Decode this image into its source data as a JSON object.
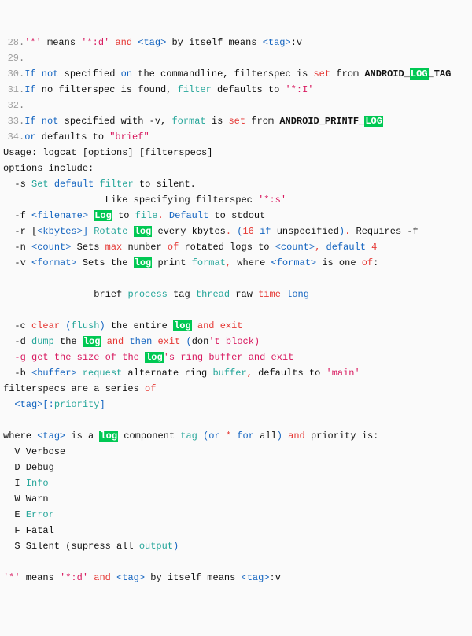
{
  "l28": {
    "ln": "28",
    "star": "'*'",
    "means": " means ",
    "starD": "'*:d'",
    "and": " and ",
    "tag": "<tag>",
    "by": " by itself means ",
    "tag2": "<tag>",
    "v": ":v"
  },
  "l29": {
    "ln": "29"
  },
  "l30": {
    "ln": "30",
    "if": "If",
    "not": " not ",
    "spec": "specified ",
    "on": "on",
    "rest": " the commandline, filterspec is ",
    "set": "set",
    "from": " from ",
    "a": "ANDROID_",
    "log": "LOG",
    "tag": "_TAG"
  },
  "l31": {
    "ln": "31",
    "if": "If",
    "rest": " no filterspec is found, ",
    "filter": "filter",
    "def": " defaults to ",
    "val": "'*:I'"
  },
  "l32": {
    "ln": "32"
  },
  "l33": {
    "ln": "33",
    "if": "If",
    "not": " not ",
    "spec": "specified with -v, ",
    "format": "format",
    "is": " is ",
    "set": "set",
    "from": " from ",
    "a": "ANDROID_PRINTF_",
    "log": "LOG"
  },
  "l34": {
    "ln": "34",
    "or": "or",
    "def": " defaults to ",
    "brief": "\"brief\""
  },
  "usage": "Usage: logcat [options] [filterspecs]",
  "opts": "options include:",
  "s": {
    "flag": "  -s ",
    "set": "Set",
    "sp": " ",
    "default": "default",
    "sp2": " ",
    "filter": "filter",
    "rest": " to silent."
  },
  "s2": {
    "lead": "                  Like specifying filterspec ",
    "val": "'*:s'"
  },
  "f": {
    "flag": "  -f ",
    "fn": "<filename>",
    "sp": " ",
    "log": "Log",
    "to": " to ",
    "file": "file",
    "dot": ".",
    "def": " Default",
    "rest": " to stdout"
  },
  "r": {
    "flag": "  -r [",
    "kb": "<kbytes>",
    "br": "]",
    "rot": " Rotate ",
    "log": "log",
    "ev": " every kbytes",
    "dot": ".",
    "sp": " (",
    "n16": "16",
    "if": " if ",
    "un": "unspecified",
    "cb": ")",
    "dot2": ".",
    "req": " Requires ",
    "f": "-f"
  },
  "n": {
    "flag": "  -n ",
    "cnt": "<count>",
    "sets": " Sets ",
    "max": "max",
    "num": " number ",
    "of": "of",
    "rot": " rotated logs to ",
    "cnt2": "<count>",
    "c": ",",
    "def": " default",
    "four": " 4"
  },
  "v": {
    "flag": "  -v ",
    "fmt": "<format>",
    "sets": " Sets the ",
    "log": "log",
    "print": " print ",
    "format": "format",
    "c": ",",
    "wh": " where ",
    "fmt2": "<format>",
    "is": " is one ",
    "of": "of",
    "col": ":"
  },
  "fmts": {
    "lead": "                brief ",
    "proc": "process",
    "tag": " tag ",
    "thr": "thread",
    "raw": " raw ",
    "time": "time",
    "sp": " ",
    "long": "long"
  },
  "c": {
    "flag": "  -c ",
    "clear": "clear",
    "op": " (",
    "flush": "flush",
    "cp": ")",
    "the": " the entire ",
    "log": "log",
    "and": " and ",
    "exit": "exit"
  },
  "d": {
    "flag": "  -d ",
    "dump": "dump",
    "the": " the ",
    "log": "log",
    "and": " and ",
    "then": "then ",
    "exit": "exit",
    "op": " (",
    "don": "don",
    "tb": "'t block)"
  },
  "g": {
    "flag": "  -g ",
    "get": "get",
    "sp": " the ",
    "size": "size",
    "of": " of ",
    "the": "the ",
    "log": "log",
    "ap": "'s",
    "ring": " ring ",
    "buf": "buffer",
    "and": " and ",
    "exit": "exit"
  },
  "b": {
    "flag": "  -b ",
    "buf": "<buffer>",
    "req": " request",
    "alt": " alternate ring ",
    "buf2": "buffer",
    "c": ",",
    "def": " defaults to ",
    "main": "'main'"
  },
  "fs": {
    "txt": "filterspecs are a series ",
    "of": "of"
  },
  "fs2": {
    "sp": "  ",
    "tag": "<tag>",
    "br": "[:",
    "pri": "priority",
    "cb": "]"
  },
  "wh": {
    "where": "where ",
    "tag": "<tag>",
    "is": " is a ",
    "log": "log",
    "comp": " component ",
    "tagw": "tag",
    "op": " (",
    "or": "or",
    "sp": " ",
    "star": "*",
    "for": " for ",
    "all": "all",
    "cp": ")",
    "and": " and ",
    "pri": "priority is:"
  },
  "pv": "  V Verbose",
  "pd": "  D Debug",
  "pi": {
    "i": "  I ",
    "info": "Info"
  },
  "pw": "  W Warn",
  "pe": {
    "e": "  E ",
    "err": "Error"
  },
  "pf": "  F Fatal",
  "ps": {
    "s": "  S Silent (supress all ",
    "out": "output",
    "cp": ")"
  },
  "last": {
    "star": "'*'",
    "means": " means ",
    "starD": "'*:d'",
    "and": " and ",
    "tag": "<tag>",
    "by": " by itself means ",
    "tag2": "<tag>",
    "v": ":v"
  }
}
